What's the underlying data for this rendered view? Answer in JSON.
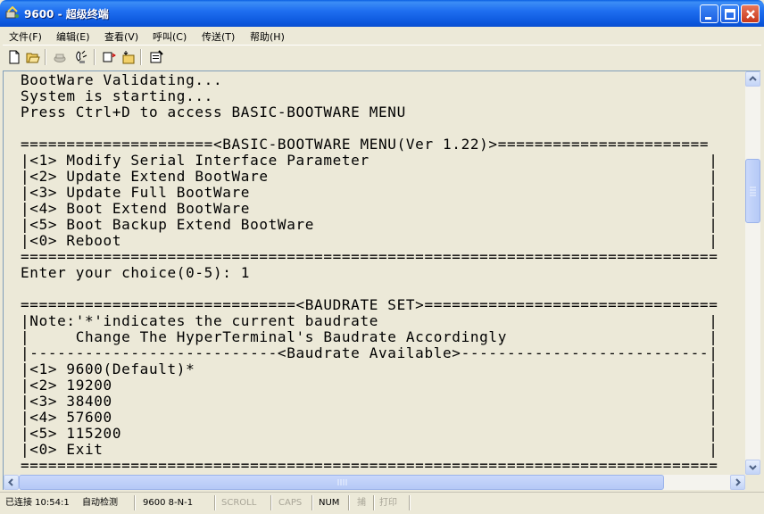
{
  "window": {
    "title": "9600 - 超级终端"
  },
  "menu": {
    "items": [
      {
        "label": "文件(F)"
      },
      {
        "label": "编辑(E)"
      },
      {
        "label": "查看(V)"
      },
      {
        "label": "呼叫(C)"
      },
      {
        "label": "传送(T)"
      },
      {
        "label": "帮助(H)"
      }
    ]
  },
  "toolbar": {
    "icons": [
      "new-icon",
      "open-icon",
      "call-icon",
      "disconnect-icon",
      "send-icon",
      "receive-icon",
      "properties-icon"
    ]
  },
  "terminal": {
    "lines": [
      "BootWare Validating...",
      "System is starting...",
      "Press Ctrl+D to access BASIC-BOOTWARE MENU",
      "",
      "=====================<BASIC-BOOTWARE MENU(Ver 1.22)>=======================",
      "|<1> Modify Serial Interface Parameter                                     |",
      "|<2> Update Extend BootWare                                                |",
      "|<3> Update Full BootWare                                                  |",
      "|<4> Boot Extend BootWare                                                  |",
      "|<5> Boot Backup Extend BootWare                                           |",
      "|<0> Reboot                                                                |",
      "============================================================================",
      "Enter your choice(0-5): 1",
      "",
      "==============================<BAUDRATE SET>================================",
      "|Note:'*'indicates the current baudrate                                    |",
      "|     Change The HyperTerminal's Baudrate Accordingly                      |",
      "|---------------------------<Baudrate Available>---------------------------|",
      "|<1> 9600(Default)*                                                        |",
      "|<2> 19200                                                                 |",
      "|<3> 38400                                                                 |",
      "|<4> 57600                                                                 |",
      "|<5> 115200                                                                |",
      "|<0> Exit                                                                  |",
      "============================================================================"
    ]
  },
  "statusbar": {
    "connected": "已连接 10:54:1",
    "detect": "自动检测",
    "settings": "9600 8-N-1",
    "scroll": "SCROLL",
    "caps": "CAPS",
    "num": "NUM",
    "capture": "捕",
    "print": "打印"
  },
  "colors": {
    "terminal_bg": "#ece9d8",
    "titlebar": "#0b56dc"
  }
}
